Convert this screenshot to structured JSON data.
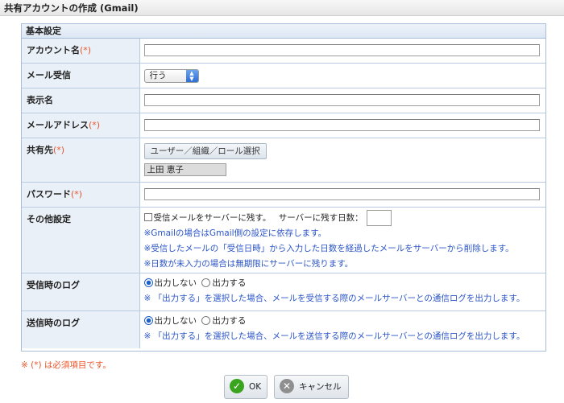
{
  "window": {
    "title": "共有アカウントの作成 (Gmail)"
  },
  "section": {
    "title": "基本設定"
  },
  "required_mark": "(*)",
  "fields": {
    "account_name": {
      "label": "アカウント名",
      "value": ""
    },
    "mail_receive": {
      "label": "メール受信",
      "selected": "行う"
    },
    "display_name": {
      "label": "表示名",
      "value": ""
    },
    "mail_address": {
      "label": "メールアドレス",
      "value": ""
    },
    "share_target": {
      "label": "共有先",
      "button": "ユーザー／組織／ロール選択",
      "selected_user": "上田 恵子"
    },
    "password": {
      "label": "パスワード",
      "value": ""
    },
    "other": {
      "label": "その他設定",
      "leave_on_server": "受信メールをサーバーに残す。",
      "days_label": "サーバーに残す日数：",
      "days_value": "",
      "note1": "※Gmailの場合はGmail側の設定に依存します。",
      "note2": "※受信したメールの「受信日時」から入力した日数を経過したメールをサーバーから削除します。",
      "note3": "※日数が未入力の場合は無期限にサーバーに残ります。"
    },
    "receive_log": {
      "label": "受信時のログ",
      "opt_off": "出力しない",
      "opt_on": "出力する",
      "note": "※ 「出力する」を選択した場合、メールを受信する際のメールサーバーとの通信ログを出力します。"
    },
    "send_log": {
      "label": "送信時のログ",
      "opt_off": "出力しない",
      "opt_on": "出力する",
      "note": "※ 「出力する」を選択した場合、メールを送信する際のメールサーバーとの通信ログを出力します。"
    }
  },
  "footer": {
    "required_note": "※ (*) は必須項目です。",
    "ok_label": "OK",
    "cancel_label": "キャンセル"
  },
  "colors": {
    "required": "#e8552b",
    "note": "#2b55c8",
    "label_bg": "#eaf0f7"
  }
}
